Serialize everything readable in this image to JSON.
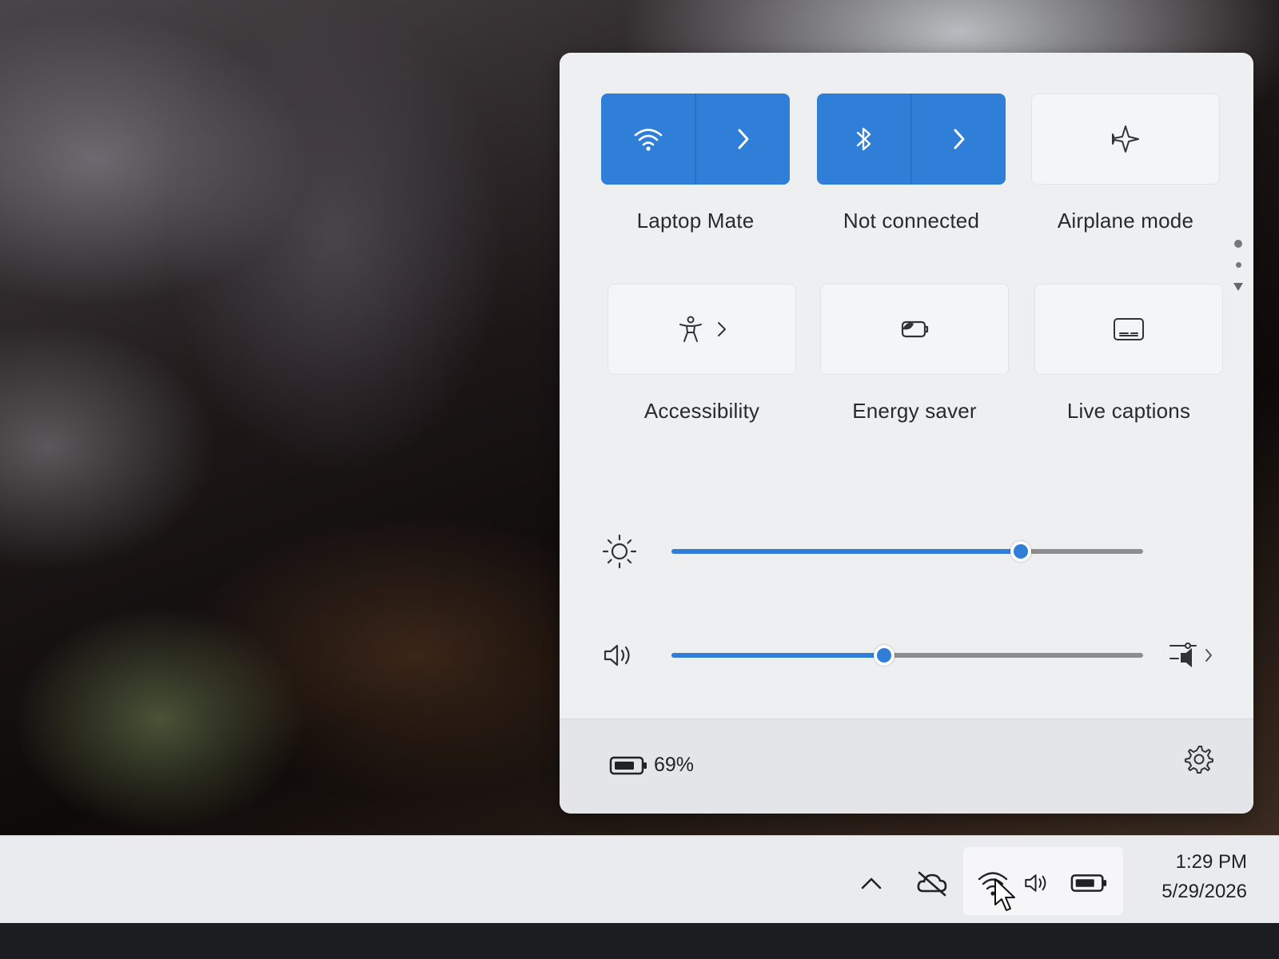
{
  "quick_settings": {
    "tiles": [
      {
        "id": "wifi",
        "label": "Laptop Mate",
        "state": "on",
        "icon": "wifi-icon",
        "has_expand": true
      },
      {
        "id": "bluetooth",
        "label": "Not connected",
        "state": "on",
        "icon": "bluetooth-icon",
        "has_expand": true
      },
      {
        "id": "airplane",
        "label": "Airplane mode",
        "state": "off",
        "icon": "airplane-icon"
      },
      {
        "id": "accessibility",
        "label": "Accessibility",
        "state": "off",
        "icon": "accessibility-icon",
        "has_expand": true
      },
      {
        "id": "energy_saver",
        "label": "Energy saver",
        "state": "off",
        "icon": "energy-saver-icon"
      },
      {
        "id": "live_captions",
        "label": "Live captions",
        "state": "off",
        "icon": "live-captions-icon"
      }
    ],
    "brightness": {
      "icon": "brightness-icon",
      "level": 0.74
    },
    "volume": {
      "icon": "speaker-icon",
      "level": 0.45,
      "mixer_icon": "audio-mixer-icon"
    },
    "battery": {
      "icon": "battery-icon",
      "percent_text": "69%"
    },
    "settings_icon": "gear-icon",
    "accent_color": "#2f7fd8"
  },
  "taskbar": {
    "tray": {
      "overflow_icon": "chevron-up-icon",
      "onedrive_icon": "cloud-off-icon",
      "network_icon": "wifi-icon",
      "volume_icon": "speaker-icon",
      "battery_icon": "battery-icon"
    },
    "clock": {
      "time": "1:29 PM",
      "date": "5/29/2026"
    }
  }
}
